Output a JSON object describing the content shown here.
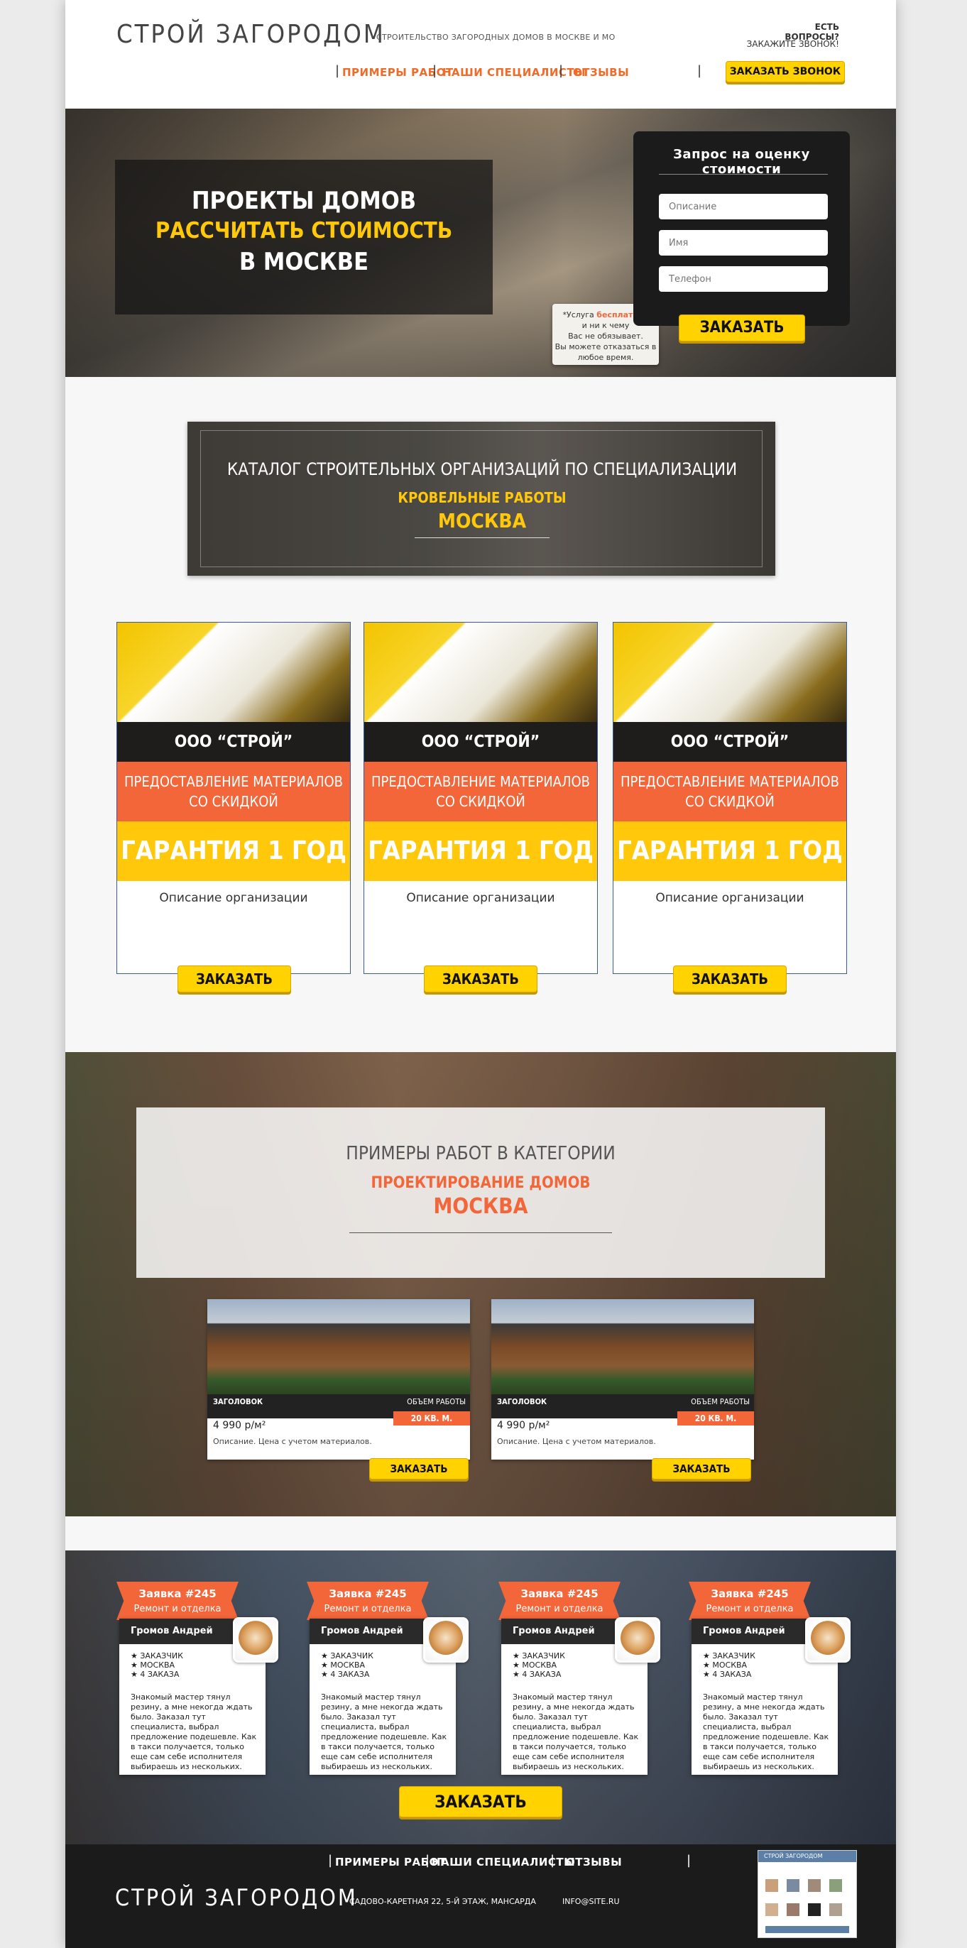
{
  "header": {
    "logo": "СТРОЙ ЗАГОРОДОМ",
    "tagline": "СТРОИТЕЛЬСТВО ЗАГОРОДНЫХ ДОМОВ В МОСКВЕ И МО",
    "questions": "ЕСТЬ ВОПРОСЫ?",
    "callme": "ЗАКАЖИТЕ ЗВОНОК!",
    "call_button": "ЗАКАЗАТЬ ЗВОНОК",
    "nav": [
      "ПРИМЕРЫ РАБОТ",
      "НАШИ СПЕЦИАЛИСТЫ",
      "ОТЗЫВЫ"
    ]
  },
  "hero": {
    "line1": "ПРОЕКТЫ ДОМОВ",
    "line2": "РАССЧИТАТЬ СТОИМОСТЬ",
    "line3": "В МОСКВЕ",
    "form_title": "Запрос на оценку стоимости",
    "placeholders": {
      "description": "Описание",
      "name": "Имя",
      "phone": "Телефон"
    },
    "submit": "ЗАКАЗАТЬ",
    "note_prefix": "*Услуга ",
    "note_free": "бесплатная",
    "note_rest1": "и ни к чему",
    "note_rest2": "Вас не обязывает.",
    "note_rest3": "Вы можете отказаться в",
    "note_rest4": "любое время."
  },
  "catalog": {
    "title": "КАТАЛОГ СТРОИТЕЛЬНЫХ ОРГАНИЗАЦИЙ ПО СПЕЦИАЛИЗАЦИИ",
    "category": "КРОВЕЛЬНЫЕ РАБОТЫ",
    "city": "МОСКВА"
  },
  "cards": [
    {
      "name": "ООО “СТРОЙ”",
      "offer1": "ПРЕДОСТАВЛЕНИЕ МАТЕРИАЛОВ",
      "offer2": "СО СКИДКОЙ",
      "guarantee": "ГАРАНТИЯ 1 ГОД",
      "desc": "Описание организации",
      "button": "ЗАКАЗАТЬ"
    },
    {
      "name": "ООО “СТРОЙ”",
      "offer1": "ПРЕДОСТАВЛЕНИЕ МАТЕРИАЛОВ",
      "offer2": "СО СКИДКОЙ",
      "guarantee": "ГАРАНТИЯ 1 ГОД",
      "desc": "Описание организации",
      "button": "ЗАКАЗАТЬ"
    },
    {
      "name": "ООО “СТРОЙ”",
      "offer1": "ПРЕДОСТАВЛЕНИЕ МАТЕРИАЛОВ",
      "offer2": "СО СКИДКОЙ",
      "guarantee": "ГАРАНТИЯ 1 ГОД",
      "desc": "Описание организации",
      "button": "ЗАКАЗАТЬ"
    }
  ],
  "works": {
    "title": "ПРИМЕРЫ РАБОТ В КАТЕГОРИИ",
    "category": "ПРОЕКТИРОВАНИЕ ДОМОВ",
    "city": "МОСКВА",
    "items": [
      {
        "heading": "ЗАГОЛОВОК",
        "volume_label": "ОБЪЕМ РАБОТЫ",
        "volume": "20 КВ. М.",
        "price": "4 990 р/м²",
        "desc": "Описание. Цена с учетом материалов.",
        "button": "ЗАКАЗАТЬ"
      },
      {
        "heading": "ЗАГОЛОВОК",
        "volume_label": "ОБЪЕМ РАБОТЫ",
        "volume": "20 КВ. М.",
        "price": "4 990 р/м²",
        "desc": "Описание. Цена с учетом материалов.",
        "button": "ЗАКАЗАТЬ"
      }
    ]
  },
  "reviews": {
    "items": [
      {
        "order": "Заявка #245",
        "type": "Ремонт и отделка",
        "name": "Громов Андрей",
        "l1": "ЗАКАЗЧИК",
        "l2": "МОСКВА",
        "l3": "4 ЗАКАЗА",
        "text": "Знакомый мастер тянул резину, а мне некогда ждать было. Заказал тут специалиста, выбрал предложение подешевле. Как в такси получается, только еще сам себе исполнителя выбираешь из нескольких."
      },
      {
        "order": "Заявка #245",
        "type": "Ремонт и отделка",
        "name": "Громов Андрей",
        "l1": "ЗАКАЗЧИК",
        "l2": "МОСКВА",
        "l3": "4 ЗАКАЗА",
        "text": "Знакомый мастер тянул резину, а мне некогда ждать было. Заказал тут специалиста, выбрал предложение подешевле. Как в такси получается, только еще сам себе исполнителя выбираешь из нескольких."
      },
      {
        "order": "Заявка #245",
        "type": "Ремонт и отделка",
        "name": "Громов Андрей",
        "l1": "ЗАКАЗЧИК",
        "l2": "МОСКВА",
        "l3": "4 ЗАКАЗА",
        "text": "Знакомый мастер тянул резину, а мне некогда ждать было. Заказал тут специалиста, выбрал предложение подешевле. Как в такси получается, только еще сам себе исполнителя выбираешь из нескольких."
      },
      {
        "order": "Заявка #245",
        "type": "Ремонт и отделка",
        "name": "Громов Андрей",
        "l1": "ЗАКАЗЧИК",
        "l2": "МОСКВА",
        "l3": "4 ЗАКАЗА",
        "text": "Знакомый мастер тянул резину, а мне некогда ждать было. Заказал тут специалиста, выбрал предложение подешевле. Как в такси получается, только еще сам себе исполнителя выбираешь из нескольких."
      }
    ],
    "button": "ЗАКАЗАТЬ"
  },
  "footer": {
    "logo": "СТРОЙ ЗАГОРОДОМ",
    "nav": [
      "ПРИМЕРЫ РАБОТ",
      "НАШИ СПЕЦИАЛИСТЫ",
      "ОТЗЫВЫ"
    ],
    "address": "САДОВО-КАРЕТНАЯ 22, 5-Й ЭТАЖ, МАНСАРДА",
    "email": "INFO@SITE.RU",
    "widget_title": "СТРОЙ ЗАГОРОДОМ"
  },
  "colors": {
    "accent_orange": "#f2663a",
    "accent_yellow": "#ffc80a",
    "button_yellow": "#ffd200",
    "dark": "#1b1b1b"
  }
}
